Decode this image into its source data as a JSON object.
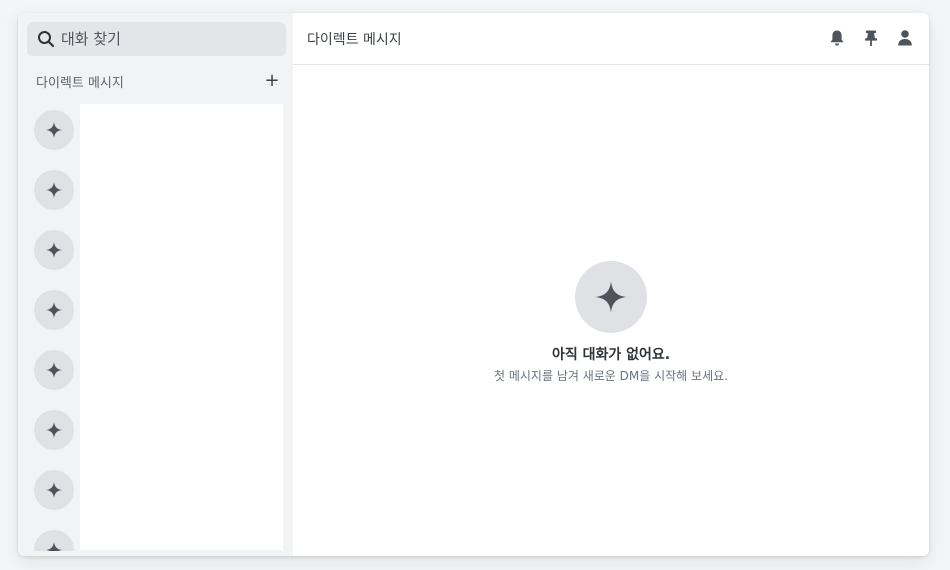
{
  "sidebar": {
    "search": {
      "placeholder": "대화 찾기",
      "icon": "search-icon"
    },
    "section_label": "다이렉트 메시지",
    "add_label": "+",
    "dm_items": [
      {
        "icon": "sparkle-icon"
      },
      {
        "icon": "sparkle-icon"
      },
      {
        "icon": "sparkle-icon"
      },
      {
        "icon": "sparkle-icon"
      },
      {
        "icon": "sparkle-icon"
      },
      {
        "icon": "sparkle-icon"
      },
      {
        "icon": "sparkle-icon"
      },
      {
        "icon": "sparkle-icon"
      }
    ]
  },
  "header": {
    "title": "다이렉트 메시지",
    "actions": [
      "bell-icon",
      "pin-icon",
      "user-icon"
    ]
  },
  "empty_state": {
    "icon": "sparkle-icon",
    "title": "아직 대화가 없어요.",
    "subtitle": "첫 메시지를 남겨 새로운 DM을 시작해 보세요."
  },
  "colors": {
    "sidebar_bg": "#f2f3f5",
    "avatar_bg": "#e0e1e5",
    "icon": "#4f545c",
    "text": "#2e3338"
  }
}
